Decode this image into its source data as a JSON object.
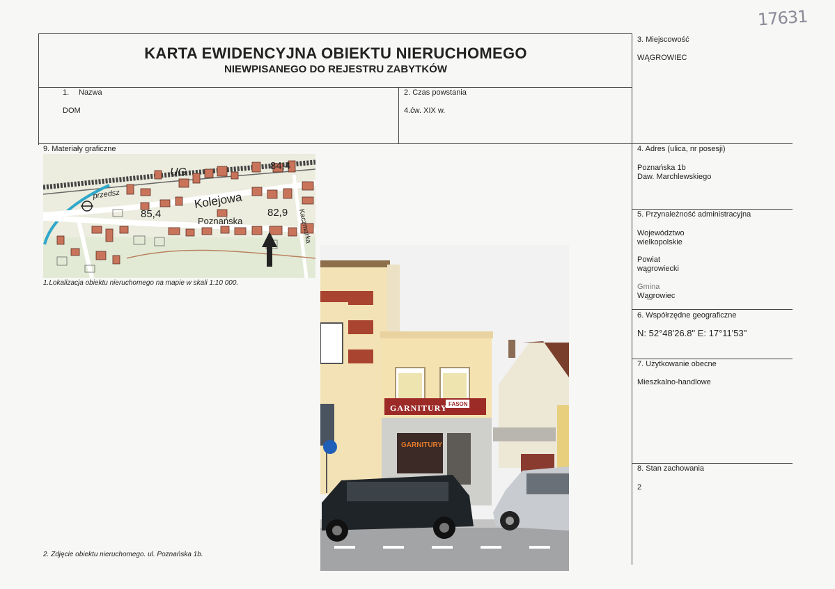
{
  "stamp_number": "17631",
  "header": {
    "title": "KARTA EWIDENCYJNA OBIEKTU NIERUCHOMEGO",
    "subtitle": "NIEWPISANEGO DO REJESTRU ZABYTKÓW"
  },
  "fields": {
    "nazwa": {
      "label_num": "1.",
      "label": "Nazwa",
      "value": "DOM"
    },
    "czas": {
      "label": "2. Czas powstania",
      "value": "4.ćw. XIX w."
    },
    "miejscowosc": {
      "label": "3. Miejscowość",
      "value": "WĄGROWIEC"
    },
    "adres": {
      "label": "4. Adres (ulica, nr posesji)",
      "line1": "Poznańska 1b",
      "line2": "Daw. Marchlewskiego"
    },
    "przynaleznosc": {
      "label": "5. Przynależność administracyjna",
      "wojewodztwo_label": "Województwo",
      "wojewodztwo": "wielkopolskie",
      "powiat_label": "Powiat",
      "powiat": "wągrowiecki",
      "gmina_label": "Gmina",
      "gmina": "Wągrowiec"
    },
    "wspolrzedne": {
      "label": "6. Współrzędne geograficzne",
      "value": "N: 52°48'26.8\"  E: 17°11'53\""
    },
    "uzytkowanie": {
      "label": "7. Użytkowanie obecne",
      "value": "Mieszkalno-handlowe"
    },
    "stan": {
      "label": "8. Stan zachowania",
      "value": "2"
    },
    "materialy": {
      "label": "9. Materiały graficzne"
    }
  },
  "map": {
    "labels": {
      "ug": "UG",
      "h1": "84,4",
      "h2": "85,4",
      "h3": "82,9",
      "street1": "Kolejowa",
      "street2": "Poznańska",
      "street3": "przedsz",
      "street4": "Kaczmarka"
    }
  },
  "photo": {
    "sign_main": "GARNITURY",
    "sign_brand": "FASON",
    "sign_window": "GARNITURY"
  },
  "captions": {
    "map": "1.Lokalizacja obiektu nieruchomego na mapie w skali 1:10 000.",
    "photo": "2. Zdjęcie obiektu nieruchomego. ul. Poznańska 1b."
  },
  "colors": {
    "building": "#c9745a",
    "water": "#2fa7c9",
    "map_bg": "#ececdf"
  }
}
